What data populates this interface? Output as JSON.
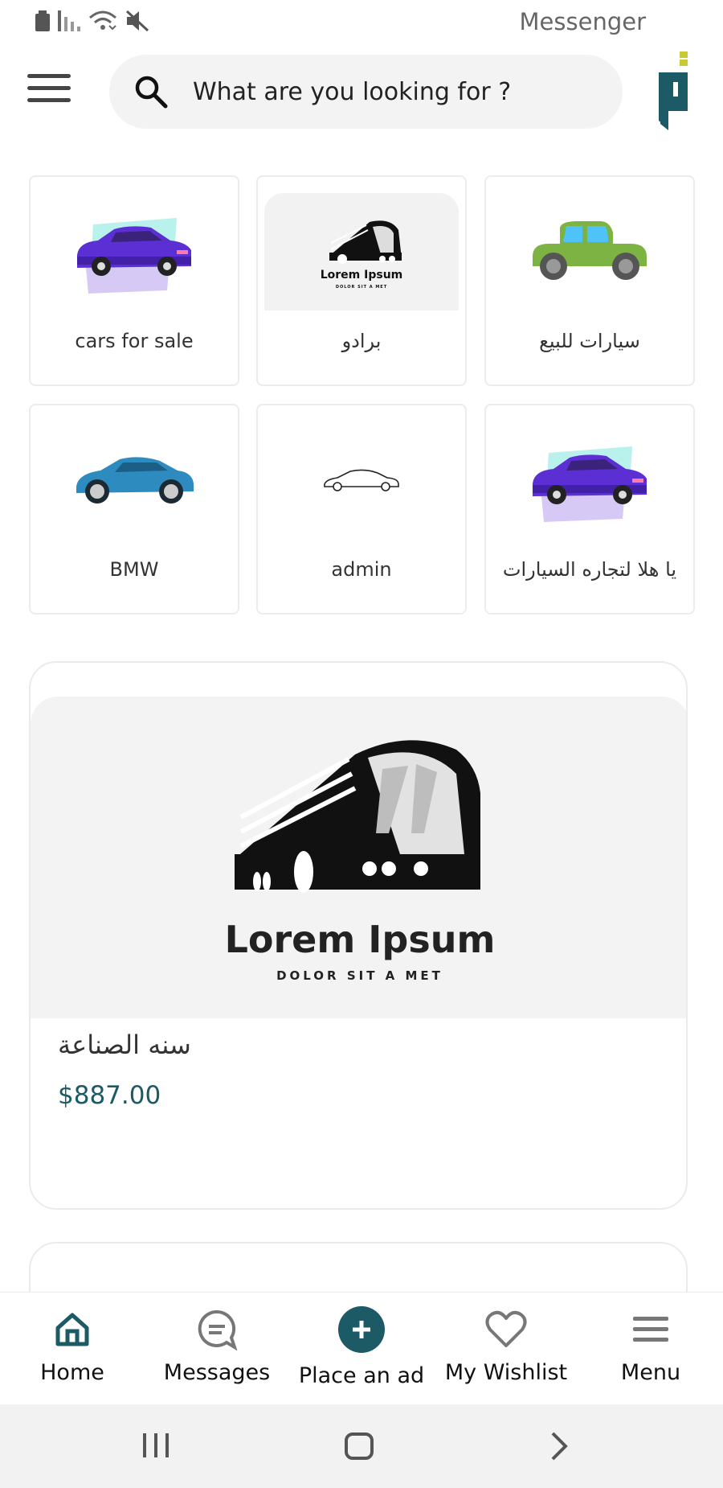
{
  "status_bar": {
    "app_name": "Messenger",
    "icons": [
      "battery-icon",
      "signal-icon",
      "wifi-icon",
      "mute-icon"
    ]
  },
  "header": {
    "menu_icon": "hamburger-icon",
    "search": {
      "placeholder": "What are you looking for ?",
      "icon": "search-icon"
    },
    "logo": "brand-logo"
  },
  "categories": [
    {
      "label": "cars for sale",
      "image": "purple-car"
    },
    {
      "label": "برادو",
      "image": "bus-logo",
      "logo_title": "Lorem Ipsum",
      "logo_subtitle": "DOLOR SIT A MET"
    },
    {
      "label": "سيارات للبيع",
      "image": "green-vintage-car"
    },
    {
      "label": "BMW",
      "image": "blue-sports-car"
    },
    {
      "label": "admin",
      "image": "outline-car"
    },
    {
      "label": "يا هلا لتجاره السيارات",
      "image": "purple-car"
    }
  ],
  "featured_product": {
    "logo_title": "Lorem Ipsum",
    "logo_subtitle": "DOLOR SIT A MET",
    "title": "سنه الصناعة",
    "price": "$887.00"
  },
  "bottom_nav": {
    "accent_color": "#1c5a66",
    "items": [
      {
        "label": "Home",
        "icon": "home-icon"
      },
      {
        "label": "Messages",
        "icon": "messages-icon"
      },
      {
        "label": "Place an ad",
        "icon": "plus-circle-icon"
      },
      {
        "label": "My Wishlist",
        "icon": "heart-icon"
      },
      {
        "label": "Menu",
        "icon": "menu-icon"
      }
    ]
  },
  "system_nav": {
    "icons": [
      "recent-apps-icon",
      "home-button-icon",
      "back-icon"
    ]
  }
}
